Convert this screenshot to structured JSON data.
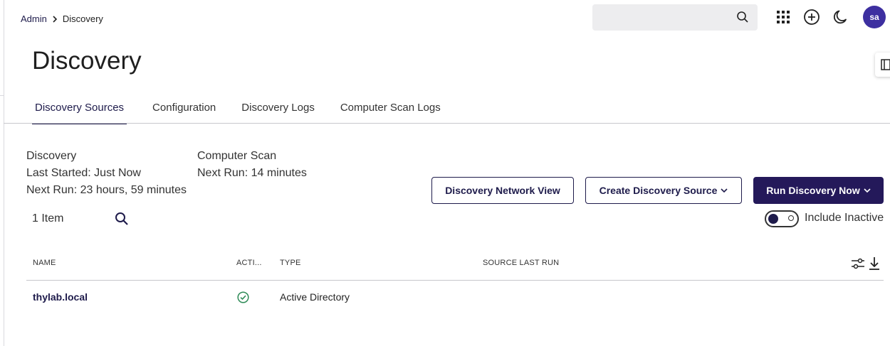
{
  "breadcrumb": {
    "parent": "Admin",
    "current": "Discovery"
  },
  "header": {
    "search_value": "",
    "search_placeholder": "",
    "icons": [
      "apps-grid-icon",
      "add-circle-icon",
      "dark-mode-moon-icon"
    ],
    "avatar_initials": "sa"
  },
  "page": {
    "title": "Discovery"
  },
  "tabs": [
    {
      "label": "Discovery Sources",
      "active": true
    },
    {
      "label": "Configuration",
      "active": false
    },
    {
      "label": "Discovery Logs",
      "active": false
    },
    {
      "label": "Computer Scan Logs",
      "active": false
    }
  ],
  "summary": {
    "discovery": {
      "heading": "Discovery",
      "last_started": "Last Started: Just Now",
      "next_run": "Next Run: 23 hours, 59 minutes"
    },
    "computer_scan": {
      "heading": "Computer Scan",
      "next_run": "Next Run: 14 minutes"
    }
  },
  "actions": {
    "network_view": "Discovery Network View",
    "create_source": "Create Discovery Source",
    "run_now": "Run Discovery Now"
  },
  "list": {
    "item_count": "1 Item",
    "include_inactive_label": "Include Inactive",
    "include_inactive": true
  },
  "table": {
    "columns": [
      "NAME",
      "ACTI...",
      "TYPE",
      "SOURCE LAST RUN"
    ],
    "rows": [
      {
        "name": "thylab.local",
        "active": true,
        "type": "Active Directory",
        "source_last_run": ""
      }
    ]
  },
  "colors": {
    "brand": "#1e1b4b",
    "primary_button": "#24195a",
    "avatar": "#3d2fa0",
    "success": "#2e8b57"
  }
}
